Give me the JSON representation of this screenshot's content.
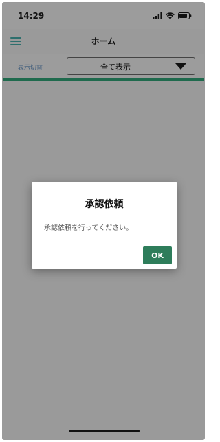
{
  "status_bar": {
    "time": "14:29",
    "icons": [
      "signal-icon",
      "wifi-icon",
      "battery-icon"
    ]
  },
  "header": {
    "title": "ホーム",
    "menu_icon": "hamburger-menu-icon"
  },
  "filter": {
    "label": "表示切替",
    "selected": "全て表示",
    "dropdown_icon": "triangle-down-icon"
  },
  "dialog": {
    "title": "承認依頼",
    "message": "承認依頼を行ってください。",
    "ok_label": "OK"
  },
  "colors": {
    "accent": "#1f6a4d",
    "button": "#2e7d5b",
    "overlay": "#9a9a9a"
  }
}
